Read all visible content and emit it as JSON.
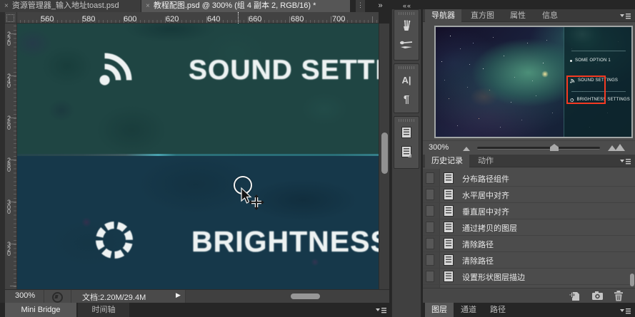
{
  "tabbar": {
    "tabs": [
      {
        "close": "×",
        "label": "资源管理器_输入地址toast.psd"
      },
      {
        "close": "×",
        "label": "教程配图.psd @ 300% (组 4 副本 2, RGB/16) *"
      }
    ],
    "sliver": "⋮",
    "overflow": "»",
    "dock_collapse": "««"
  },
  "rulers": {
    "top": [
      "560",
      "580",
      "600",
      "620",
      "640",
      "660",
      "680",
      "700"
    ],
    "left": [
      "220",
      "240",
      "260",
      "280",
      "300",
      "320"
    ]
  },
  "canvas": {
    "sound_title": "SOUND SETTIN",
    "brightness_title": "BRIGHTNESS S"
  },
  "dock": {
    "character_glyph": "A|",
    "paragraph_glyph": "¶",
    "icons": [
      "brush-presets",
      "tool-presets",
      "character-panel",
      "paragraph-panel",
      "character-styles",
      "paragraph-styles"
    ]
  },
  "navigator": {
    "tabs": [
      "导航器",
      "直方图",
      "属性",
      "信息"
    ],
    "zoom": "300%",
    "overlay_menu": [
      "SOME OPTION 1",
      "SOUND SETTINGS",
      "BRIGHTNESS SETTINGS"
    ]
  },
  "history": {
    "tabs": [
      "历史记录",
      "动作"
    ],
    "items": [
      "分布路径组件",
      "水平居中对齐",
      "垂直居中对齐",
      "通过拷贝的图层",
      "清除路径",
      "清除路径",
      "设置形状图层描边"
    ]
  },
  "layers": {
    "tabs": [
      "图层",
      "通道",
      "路径"
    ]
  },
  "statusbar": {
    "zoom": "300%",
    "doc_info": "文档:2.20M/29.4M",
    "expand": "▶"
  },
  "bottombar": {
    "tabs": [
      "Mini Bridge",
      "时间轴"
    ]
  },
  "colors": {
    "canvas_top": "#1f4543",
    "canvas_bottom": "#16384a",
    "divider_teal": "#2b6f79",
    "viewbox_red": "#f53a22",
    "panel_bg": "#4c4c4c"
  }
}
